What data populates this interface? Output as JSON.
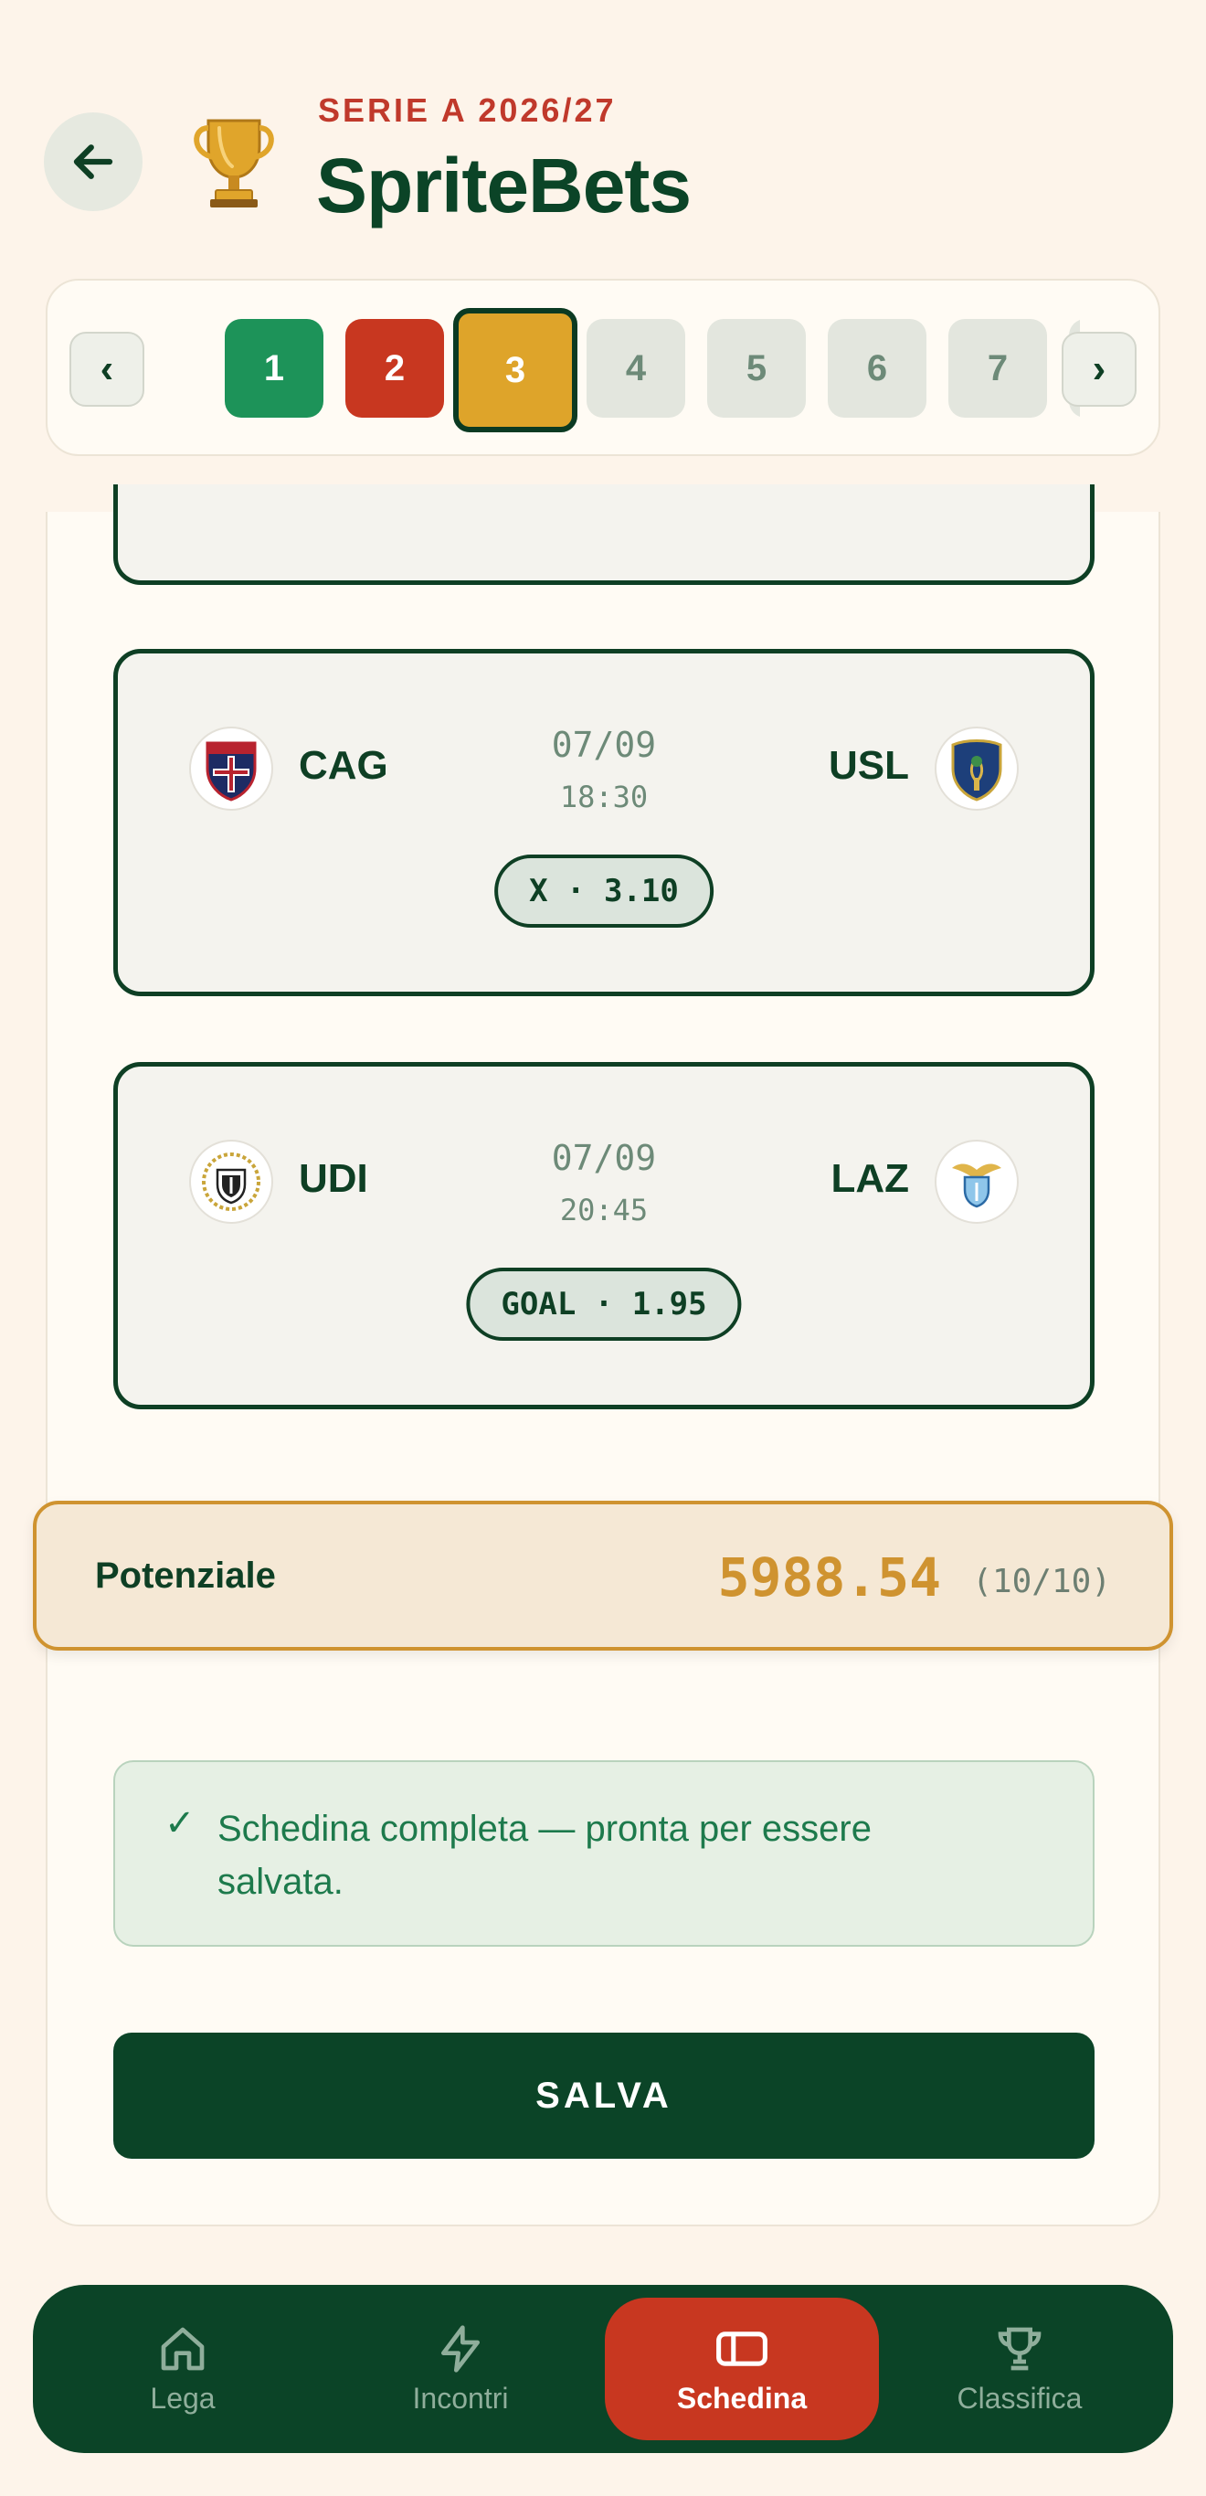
{
  "header": {
    "league_label": "SERIE A 2026/27",
    "app_title": "SpriteBets"
  },
  "matchday_selector": {
    "prev_label": "‹",
    "next_label": "›",
    "slots": [
      {
        "label": "1",
        "state": "won"
      },
      {
        "label": "2",
        "state": "lost"
      },
      {
        "label": "3",
        "state": "active"
      },
      {
        "label": "4",
        "state": "pending"
      },
      {
        "label": "5",
        "state": "pending"
      },
      {
        "label": "6",
        "state": "pending"
      },
      {
        "label": "7",
        "state": "pending"
      }
    ]
  },
  "matches": [
    {
      "home": {
        "code": "CAG",
        "logo": "cagliari-crest-icon"
      },
      "away": {
        "code": "USL",
        "logo": "lecce-crest-icon"
      },
      "date": "07/09",
      "time": "18:30",
      "pick": "X · 3.10"
    },
    {
      "home": {
        "code": "UDI",
        "logo": "udinese-crest-icon"
      },
      "away": {
        "code": "LAZ",
        "logo": "lazio-crest-icon"
      },
      "date": "07/09",
      "time": "20:45",
      "pick": "GOAL · 1.95"
    }
  ],
  "potential": {
    "label": "Potenziale",
    "value": "5988.54",
    "count": "(10/10)"
  },
  "notice": {
    "check": "✓",
    "text": "Schedina completa — pronta per essere salvata."
  },
  "save_label": "SALVA",
  "bottom_nav": [
    {
      "label": "Lega",
      "icon": "home-icon",
      "active": false
    },
    {
      "label": "Incontri",
      "icon": "lightning-icon",
      "active": false
    },
    {
      "label": "Schedina",
      "icon": "ticket-icon",
      "active": true
    },
    {
      "label": "Classifica",
      "icon": "trophy-icon",
      "active": false
    }
  ],
  "colors": {
    "background": "#fdf4ea",
    "primary_green": "#0b4427",
    "accent_red": "#c83720",
    "accent_gold": "#cf9330",
    "won_green": "#1d9359"
  }
}
